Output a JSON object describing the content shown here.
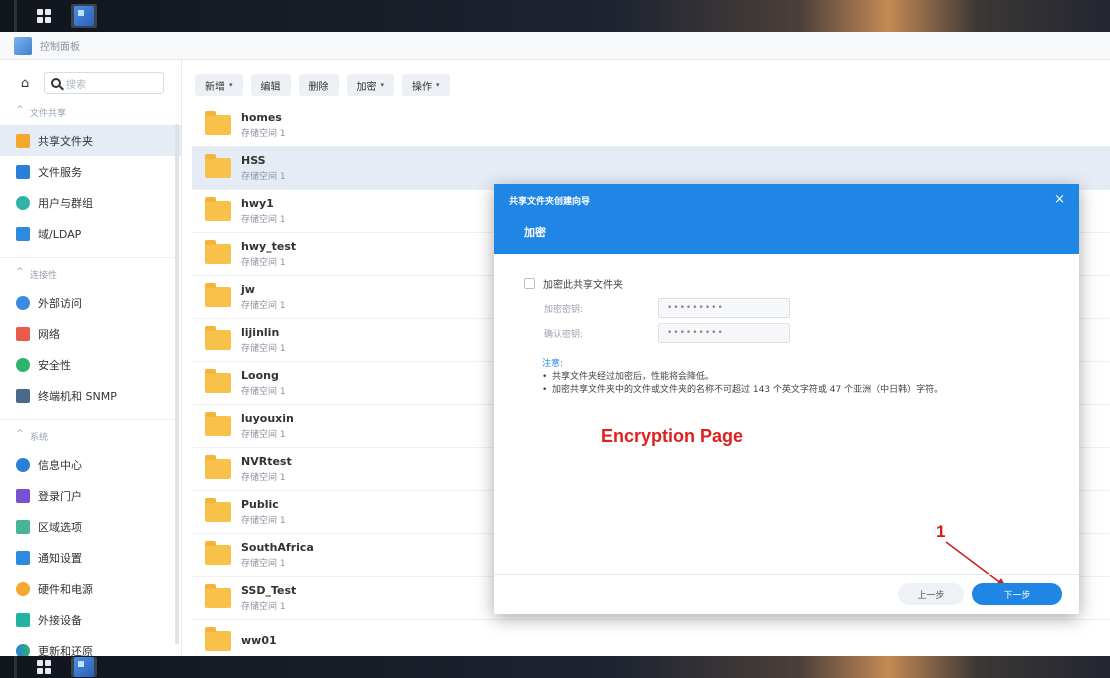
{
  "window": {
    "title": "控制面板"
  },
  "sidebar": {
    "search_placeholder": "搜索",
    "sections": [
      {
        "title": "文件共享",
        "items": [
          "共享文件夹",
          "文件服务",
          "用户与群组",
          "域/LDAP"
        ]
      },
      {
        "title": "连接性",
        "items": [
          "外部访问",
          "网络",
          "安全性",
          "终端机和 SNMP"
        ]
      },
      {
        "title": "系统",
        "items": [
          "信息中心",
          "登录门户",
          "区域选项",
          "通知设置",
          "硬件和电源",
          "外接设备",
          "更新和还原"
        ]
      }
    ]
  },
  "toolbar": {
    "create": "新增",
    "edit": "编辑",
    "delete": "删除",
    "encrypt": "加密",
    "action": "操作"
  },
  "folders": [
    {
      "name": "homes",
      "volume": "存储空间 1"
    },
    {
      "name": "HSS",
      "volume": "存储空间 1"
    },
    {
      "name": "hwy1",
      "volume": "存储空间 1"
    },
    {
      "name": "hwy_test",
      "volume": "存储空间 1"
    },
    {
      "name": "jw",
      "volume": "存储空间 1"
    },
    {
      "name": "lijinlin",
      "volume": "存储空间 1"
    },
    {
      "name": "Loong",
      "volume": "存储空间 1"
    },
    {
      "name": "luyouxin",
      "volume": "存储空间 1"
    },
    {
      "name": "NVRtest",
      "volume": "存储空间 1"
    },
    {
      "name": "Public",
      "volume": "存储空间 1"
    },
    {
      "name": "SouthAfrica",
      "volume": "存储空间 1"
    },
    {
      "name": "SSD_Test",
      "volume": "存储空间 1"
    },
    {
      "name": "ww01",
      "volume": ""
    }
  ],
  "modal": {
    "wizard_title": "共享文件夹创建向导",
    "step_title": "加密",
    "close": "×",
    "encrypt_checkbox": "加密此共享文件夹",
    "key_label": "加密密钥:",
    "key_value": "•••••••••",
    "confirm_label": "确认密钥:",
    "confirm_value": "•••••••••",
    "notes_title": "注意:",
    "note1": "共享文件夹经过加密后，性能将会降低。",
    "note2": "加密共享文件夹中的文件或文件夹的名称不可超过 143 个英文字符或 47 个亚洲（中日韩）字符。",
    "prev_button": "上一步",
    "next_button": "下一步"
  },
  "annotations": {
    "page_label": "Encryption Page",
    "step_number": "1"
  },
  "colors": {
    "accent": "#1f86e6",
    "annotation": "#e02020",
    "folder": "#f8c24a"
  }
}
